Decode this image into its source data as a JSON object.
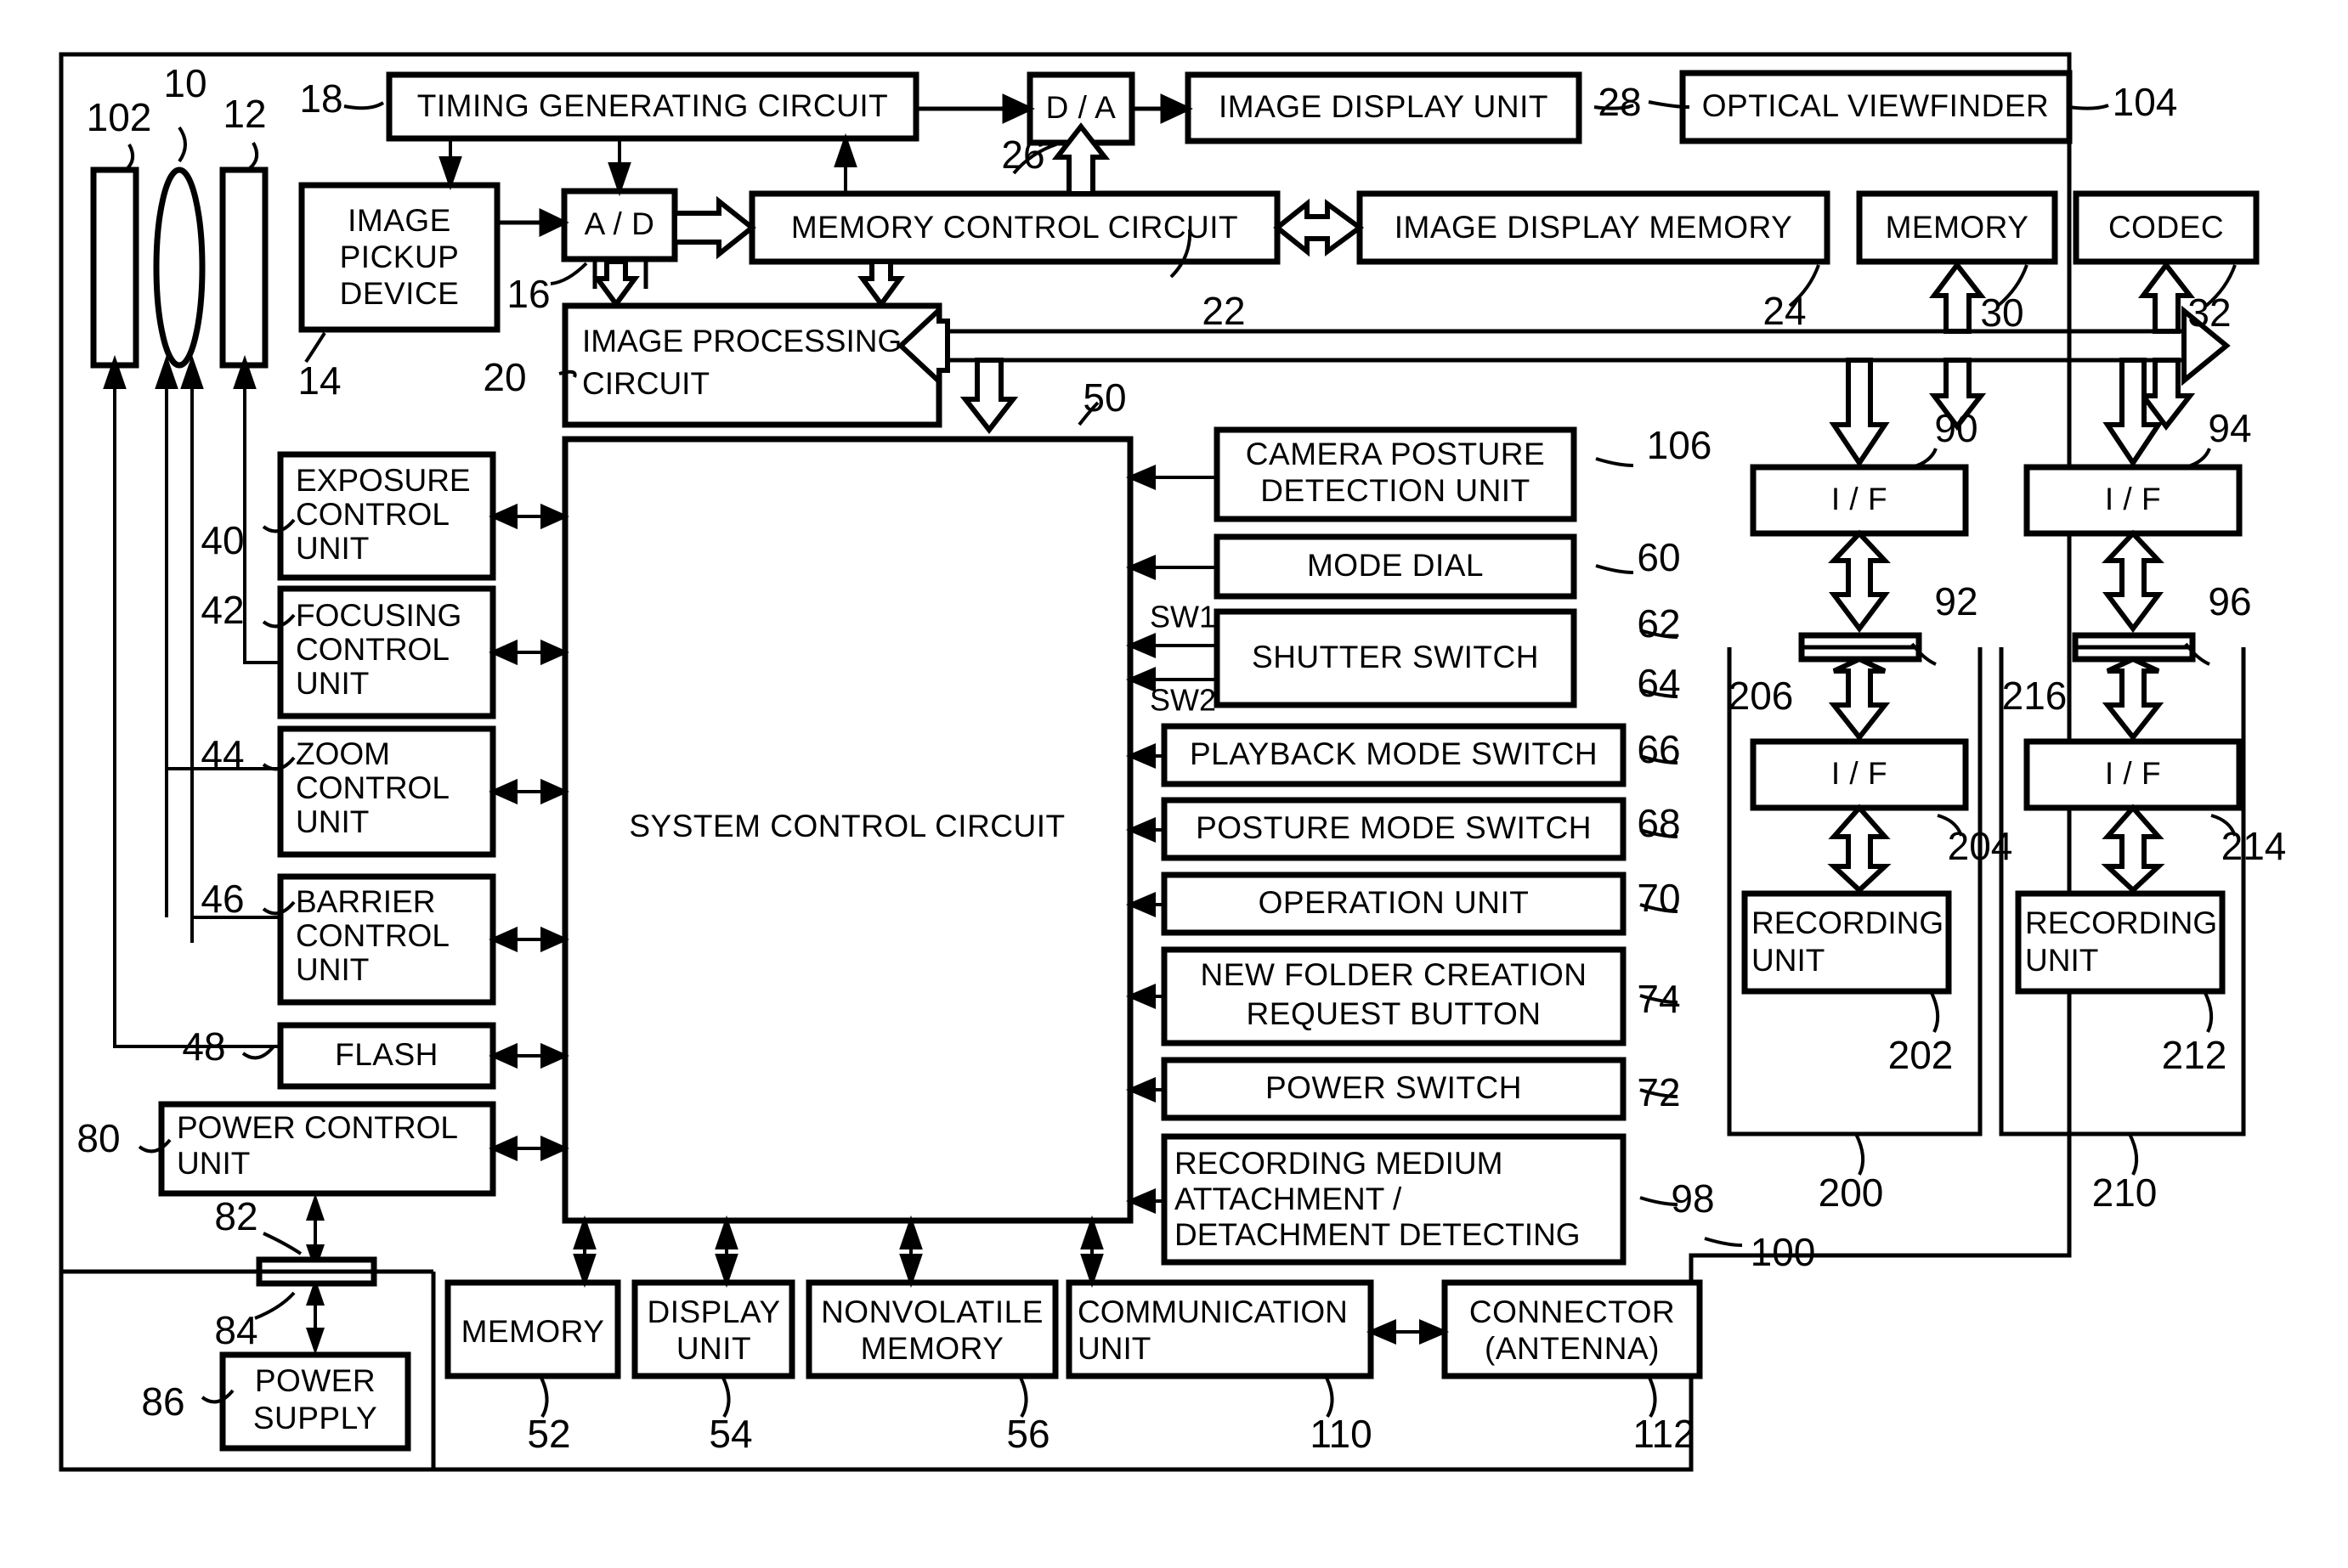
{
  "figure": {
    "type": "patent-block-diagram",
    "subject": "Digital camera system block diagram",
    "outer_frame_ref": "100"
  },
  "blocks": {
    "barrier": {
      "label": "",
      "ref": "102"
    },
    "lens": {
      "label": "",
      "ref": "10"
    },
    "shutter": {
      "label": "",
      "ref": "12"
    },
    "image_pickup_device": {
      "label": "IMAGE\nPICKUP\nDEVICE",
      "ref": "14"
    },
    "ad": {
      "label": "A / D",
      "ref": "16"
    },
    "timing_generating_circuit": {
      "label": "TIMING GENERATING CIRCUIT",
      "ref": "18"
    },
    "image_processing_circuit": {
      "label": "IMAGE PROCESSING\nCIRCUIT",
      "ref": "20"
    },
    "memory_control_circuit": {
      "label": "MEMORY CONTROL CIRCUIT",
      "ref": "22"
    },
    "image_display_memory": {
      "label": "IMAGE DISPLAY MEMORY",
      "ref": "24"
    },
    "da": {
      "label": "D / A",
      "ref": "26"
    },
    "image_display_unit": {
      "label": "IMAGE DISPLAY UNIT",
      "ref": "28"
    },
    "memory_top": {
      "label": "MEMORY",
      "ref": "30"
    },
    "codec": {
      "label": "CODEC",
      "ref": "32"
    },
    "exposure_control_unit": {
      "label": "EXPOSURE\nCONTROL\nUNIT",
      "ref": "40"
    },
    "focusing_control_unit": {
      "label": "FOCUSING\nCONTROL\nUNIT",
      "ref": "42"
    },
    "zoom_control_unit": {
      "label": "ZOOM\nCONTROL\nUNIT",
      "ref": "44"
    },
    "barrier_control_unit": {
      "label": "BARRIER\nCONTROL\nUNIT",
      "ref": "46"
    },
    "flash": {
      "label": "FLASH",
      "ref": "48"
    },
    "system_control_circuit": {
      "label": "SYSTEM CONTROL CIRCUIT",
      "ref": "50"
    },
    "memory_bottom": {
      "label": "MEMORY",
      "ref": "52"
    },
    "display_unit": {
      "label": "DISPLAY\nUNIT",
      "ref": "54"
    },
    "nonvolatile_memory": {
      "label": "NONVOLATILE\nMEMORY",
      "ref": "56"
    },
    "mode_dial": {
      "label": "MODE DIAL",
      "ref": "60"
    },
    "shutter_switch": {
      "label": "SHUTTER SWITCH",
      "ref_sw1": "62",
      "ref_sw2": "64",
      "sw1_label": "SW1",
      "sw2_label": "SW2"
    },
    "playback_mode_switch": {
      "label": "PLAYBACK MODE SWITCH",
      "ref": "66"
    },
    "posture_mode_switch": {
      "label": "POSTURE MODE SWITCH",
      "ref": "68"
    },
    "operation_unit": {
      "label": "OPERATION UNIT",
      "ref": "70"
    },
    "power_switch": {
      "label": "POWER SWITCH",
      "ref": "72"
    },
    "new_folder_creation_request_button": {
      "label": "NEW FOLDER CREATION\nREQUEST BUTTON",
      "ref": "74"
    },
    "power_control_unit": {
      "label": "POWER CONTROL\nUNIT",
      "ref": "80"
    },
    "connector_82": {
      "ref": "82"
    },
    "connector_84": {
      "ref": "84"
    },
    "power_supply": {
      "label": "POWER\nSUPPLY",
      "ref": "86"
    },
    "if_90": {
      "label": "I / F",
      "ref": "90"
    },
    "connector_92": {
      "ref": "92"
    },
    "if_94": {
      "label": "I / F",
      "ref": "94"
    },
    "connector_96": {
      "ref": "96"
    },
    "recording_medium_detect": {
      "label": "RECORDING MEDIUM\nATTACHMENT /\nDETACHMENT DETECTING",
      "ref": "98"
    },
    "camera_posture_detection_unit": {
      "label": "CAMERA POSTURE\nDETECTION UNIT",
      "ref": "106"
    },
    "optical_viewfinder": {
      "label": "OPTICAL VIEWFINDER",
      "ref": "104"
    },
    "communication_unit": {
      "label": "COMMUNICATION\nUNIT",
      "ref": "110"
    },
    "connector_antenna": {
      "label": "CONNECTOR\n(ANTENNA)",
      "ref": "112"
    },
    "recording_medium_200": {
      "ref": "200"
    },
    "recording_unit_202": {
      "label": "RECORDING\nUNIT",
      "ref": "202"
    },
    "if_204": {
      "label": "I / F",
      "ref": "204"
    },
    "connector_206": {
      "ref": "206"
    },
    "recording_medium_210": {
      "ref": "210"
    },
    "recording_unit_212": {
      "label": "RECORDING\nUNIT",
      "ref": "212"
    },
    "if_214": {
      "label": "I / F",
      "ref": "214"
    },
    "connector_216": {
      "ref": "216"
    }
  },
  "labels": {
    "l102": "102",
    "l10": "10",
    "l12": "12",
    "l14": "14",
    "l16": "16",
    "l18": "18",
    "l20": "20",
    "l22": "22",
    "l24": "24",
    "l26": "26",
    "l28": "28",
    "l30": "30",
    "l32": "32",
    "l40": "40",
    "l42": "42",
    "l44": "44",
    "l46": "46",
    "l48": "48",
    "l50": "50",
    "l52": "52",
    "l54": "54",
    "l56": "56",
    "l60": "60",
    "l62": "62",
    "l64": "64",
    "l66": "66",
    "l68": "68",
    "l70": "70",
    "l72": "72",
    "l74": "74",
    "l80": "80",
    "l82": "82",
    "l84": "84",
    "l86": "86",
    "l90": "90",
    "l92": "92",
    "l94": "94",
    "l96": "96",
    "l98": "98",
    "l100": "100",
    "l104": "104",
    "l106": "106",
    "l110": "110",
    "l112": "112",
    "l200": "200",
    "l202": "202",
    "l204": "204",
    "l206": "206",
    "l210": "210",
    "l212": "212",
    "l214": "214",
    "l216": "216",
    "sw1": "SW1",
    "sw2": "SW2"
  },
  "text": {
    "timing_generating_circuit": "TIMING GENERATING CIRCUIT",
    "da": "D / A",
    "image_display_unit": "IMAGE DISPLAY UNIT",
    "optical_viewfinder": "OPTICAL VIEWFINDER",
    "ad": "A / D",
    "memory_control_circuit": "MEMORY CONTROL CIRCUIT",
    "image_display_memory": "IMAGE DISPLAY MEMORY",
    "memory": "MEMORY",
    "codec": "CODEC",
    "image_pickup_1": "IMAGE",
    "image_pickup_2": "PICKUP",
    "image_pickup_3": "DEVICE",
    "image_processing_1": "IMAGE PROCESSING",
    "image_processing_2": "CIRCUIT",
    "exposure_1": "EXPOSURE",
    "exposure_2": "CONTROL",
    "exposure_3": "UNIT",
    "focusing_1": "FOCUSING",
    "focusing_2": "CONTROL",
    "focusing_3": "UNIT",
    "zoom_1": "ZOOM",
    "zoom_2": "CONTROL",
    "zoom_3": "UNIT",
    "barrier_1": "BARRIER",
    "barrier_2": "CONTROL",
    "barrier_3": "UNIT",
    "flash": "FLASH",
    "power_control_1": "POWER CONTROL",
    "power_control_2": "UNIT",
    "power_supply_1": "POWER",
    "power_supply_2": "SUPPLY",
    "system_control_circuit": "SYSTEM CONTROL CIRCUIT",
    "camera_posture_1": "CAMERA POSTURE",
    "camera_posture_2": "DETECTION UNIT",
    "mode_dial": "MODE DIAL",
    "shutter_switch": "SHUTTER SWITCH",
    "playback_mode_switch": "PLAYBACK MODE SWITCH",
    "posture_mode_switch": "POSTURE MODE SWITCH",
    "operation_unit": "OPERATION UNIT",
    "new_folder_1": "NEW FOLDER CREATION",
    "new_folder_2": "REQUEST BUTTON",
    "power_switch": "POWER SWITCH",
    "rec_medium_1": "RECORDING MEDIUM",
    "rec_medium_2": "ATTACHMENT /",
    "rec_medium_3": "DETACHMENT DETECTING",
    "memory_bottom": "MEMORY",
    "display_unit_1": "DISPLAY",
    "display_unit_2": "UNIT",
    "nonvolatile_1": "NONVOLATILE",
    "nonvolatile_2": "MEMORY",
    "communication_1": "COMMUNICATION",
    "communication_2": "UNIT",
    "connector_1": "CONNECTOR",
    "connector_2": "(ANTENNA)",
    "iface": "I / F",
    "recording_unit_1": "RECORDING",
    "recording_unit_2": "UNIT"
  },
  "colors": {
    "stroke": "#000000",
    "background": "#ffffff"
  }
}
